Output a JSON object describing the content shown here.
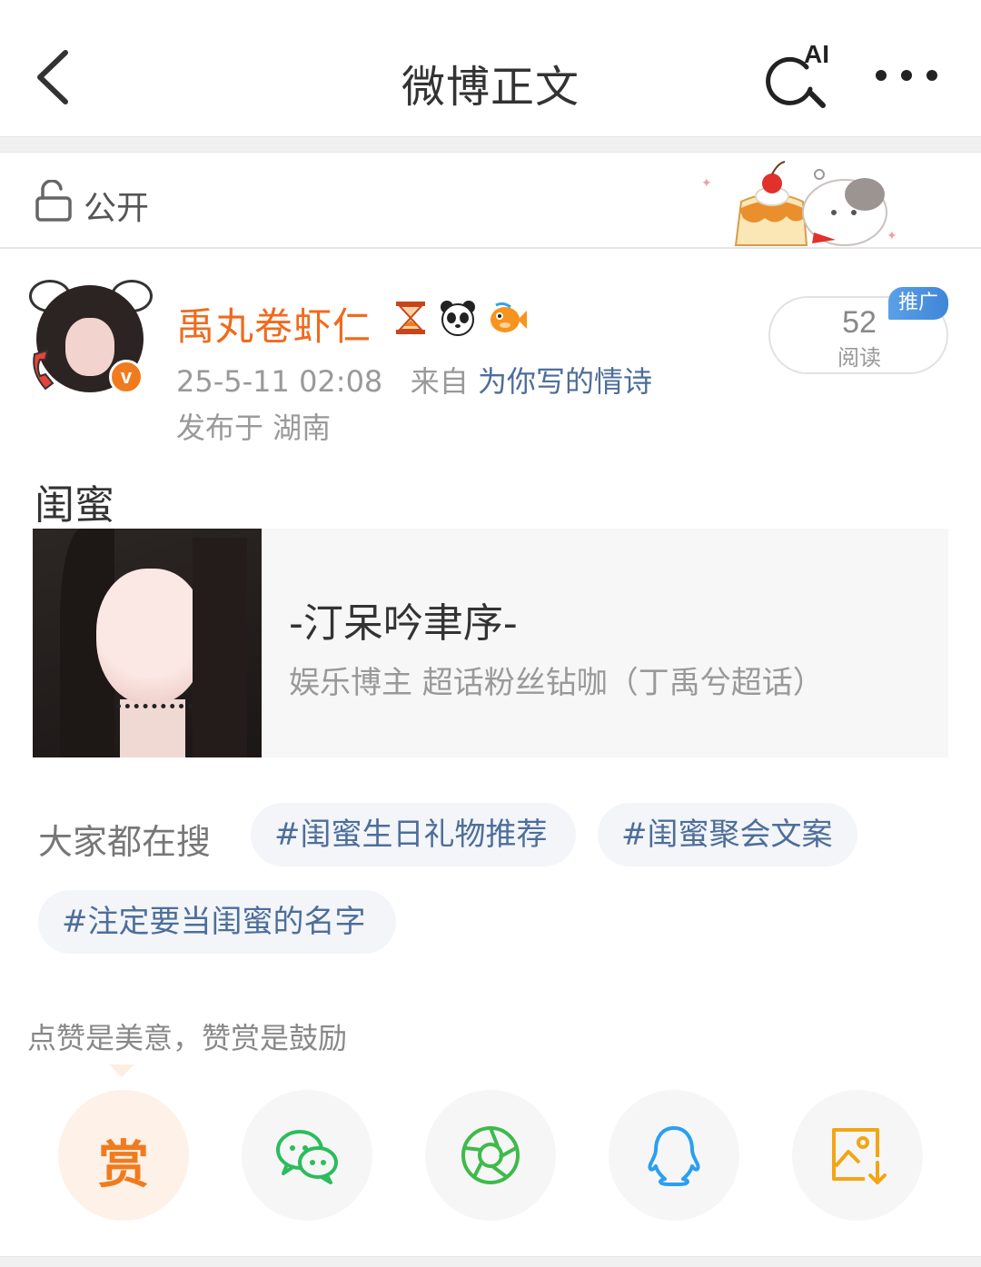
{
  "header": {
    "title": "微博正文",
    "ai_label": "AI"
  },
  "visibility": {
    "label": "公开"
  },
  "user": {
    "name": "禹丸卷虾仁",
    "verified_mark": "v",
    "time": "25-5-11 02:08",
    "from_prefix": "来自",
    "source": "为你写的情诗",
    "location": "发布于 湖南",
    "badges": [
      "hourglass-icon",
      "panda-icon",
      "fish-icon"
    ]
  },
  "reads": {
    "count": "52",
    "label": "阅读",
    "promo": "推广"
  },
  "post": {
    "text": "闺蜜",
    "card": {
      "title": "-汀呆吟聿序-",
      "subtitle": "娱乐博主 超话粉丝钻咖（丁禹兮超话）"
    }
  },
  "search": {
    "label": "大家都在搜",
    "tags": [
      "#闺蜜生日礼物推荐",
      "#闺蜜聚会文案",
      "#注定要当闺蜜的名字"
    ]
  },
  "reward": {
    "hint": "点赞是美意，赞赏是鼓励",
    "button": "赏"
  },
  "share": [
    "wechat-icon",
    "moments-icon",
    "qq-icon",
    "save-image-icon"
  ],
  "colors": {
    "username": "#f06a1e",
    "link": "#4d6e9a",
    "reward": "#f07b1e",
    "wechat": "#2bbd5d",
    "moments": "#3fba4b",
    "qq": "#2a9ff0",
    "save": "#f2a516"
  }
}
